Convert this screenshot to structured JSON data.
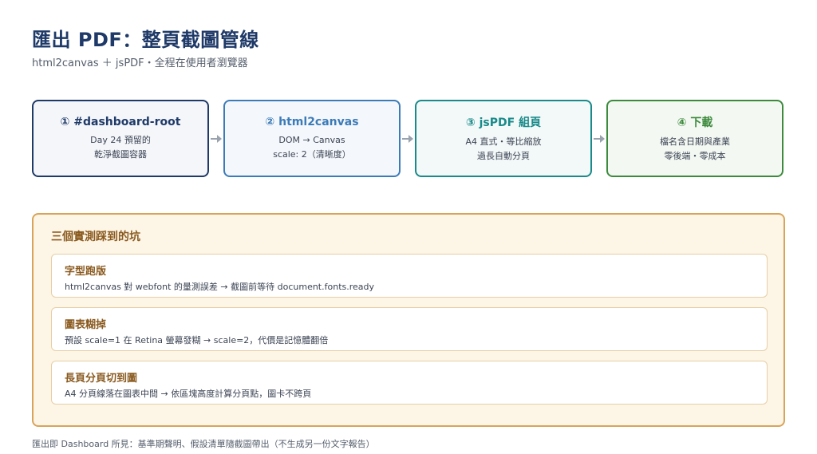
{
  "header": {
    "title": "匯出 PDF：整頁截圖管線",
    "subtitle": "html2canvas ＋ jsPDF・全程在使用者瀏覽器"
  },
  "steps": [
    {
      "title": "① #dashboard-root",
      "line1": "Day 24 預留的",
      "line2": "乾淨截圖容器",
      "color": "#1f3a68",
      "bg": "#f4f6fa"
    },
    {
      "title": "② html2canvas",
      "line1": "DOM → Canvas",
      "line2": "scale: 2（清晰度）",
      "color": "#3b7bb8",
      "bg": "#f4f7fb"
    },
    {
      "title": "③ jsPDF 組頁",
      "line1": "A4 直式・等比縮放",
      "line2": "過長自動分頁",
      "color": "#1a8a8a",
      "bg": "#f3f8f8"
    },
    {
      "title": "④ 下載",
      "line1": "檔名含日期與產業",
      "line2": "零後端・零成本",
      "color": "#3c8a3c",
      "bg": "#f4f8f3"
    }
  ],
  "pits": {
    "title": "三個實測踩到的坑",
    "items": [
      {
        "title": "字型跑版",
        "body": "html2canvas 對 webfont 的量測誤差 → 截圖前等待 document.fonts.ready"
      },
      {
        "title": "圖表糊掉",
        "body": "預設 scale=1 在 Retina 螢幕發糊 → scale=2，代價是記憶體翻倍"
      },
      {
        "title": "長頁分頁切到圖",
        "body": "A4 分頁線落在圖表中間 → 依區塊高度計算分頁點，圖卡不跨頁"
      }
    ]
  },
  "footer": "匯出即 Dashboard 所見：基準期聲明、假設清單隨截圖帶出（不生成另一份文字報告）"
}
